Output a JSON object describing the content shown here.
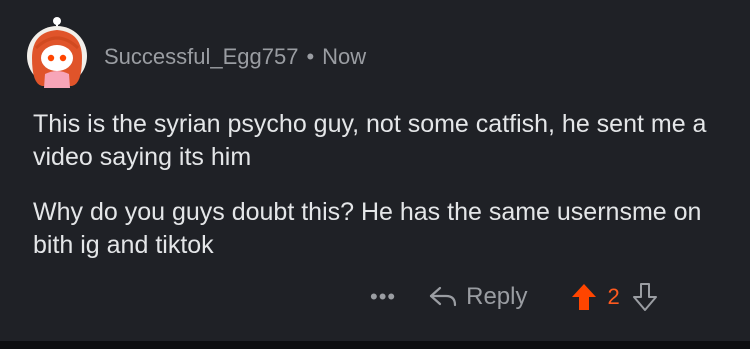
{
  "comment": {
    "author": "Successful_Egg757",
    "separator": "•",
    "timestamp": "Now",
    "paragraphs": [
      "This is the syrian psycho guy, not some catfish, he sent me a video saying its him",
      "Why do you guys doubt this? He has the same usernsme on bith ig and tiktok"
    ]
  },
  "actions": {
    "more_label": "•••",
    "reply_label": "Reply",
    "vote_count": "2"
  },
  "colors": {
    "background": "#1f2126",
    "upvote_active": "#ff4500",
    "muted_text": "#9a9da2"
  }
}
